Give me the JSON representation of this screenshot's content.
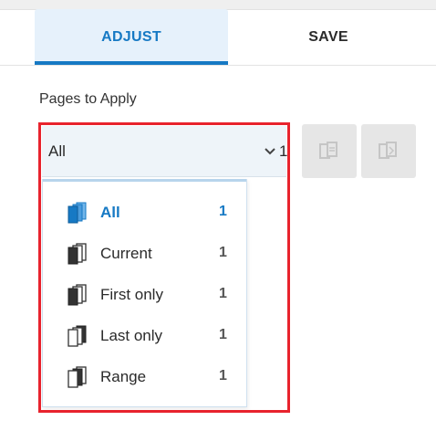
{
  "tabs": [
    {
      "label": "ADJUST",
      "active": true
    },
    {
      "label": "SAVE",
      "active": false
    }
  ],
  "section_label": "Pages to Apply",
  "select": {
    "value": "All",
    "count": "1"
  },
  "dropdown": {
    "items": [
      {
        "label": "All",
        "count": "1",
        "icon": "pages-all-icon",
        "selected": true
      },
      {
        "label": "Current",
        "count": "1",
        "icon": "pages-current-icon"
      },
      {
        "label": "First only",
        "count": "1",
        "icon": "pages-first-icon"
      },
      {
        "label": "Last only",
        "count": "1",
        "icon": "pages-last-icon"
      },
      {
        "label": "Range",
        "count": "1",
        "icon": "pages-range-icon"
      }
    ]
  },
  "colors": {
    "accent": "#1679c4",
    "highlight": "#e8232d",
    "tab_active_bg": "#e6f1fb"
  }
}
